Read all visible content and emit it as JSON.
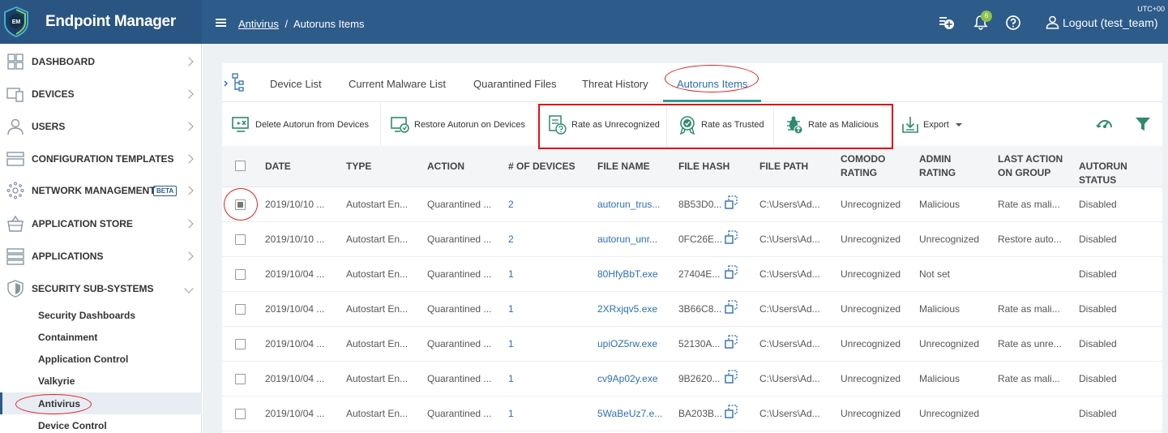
{
  "header": {
    "logo_text": "EM",
    "app_title": "Endpoint Manager",
    "breadcrumb_link": "Antivirus",
    "breadcrumb_sep": "/",
    "breadcrumb_current": "Autoruns Items",
    "timezone": "UTC+00",
    "notification_count": "6",
    "logout_label": "Logout (test_team)"
  },
  "sidebar": {
    "items": [
      {
        "label": "DASHBOARD",
        "icon": "dashboard-grid-icon"
      },
      {
        "label": "DEVICES",
        "icon": "devices-icon"
      },
      {
        "label": "USERS",
        "icon": "user-icon"
      },
      {
        "label": "CONFIGURATION TEMPLATES",
        "icon": "templates-icon"
      },
      {
        "label": "NETWORK MANAGEMENT",
        "icon": "network-icon",
        "badge": "BETA"
      },
      {
        "label": "APPLICATION STORE",
        "icon": "store-icon"
      },
      {
        "label": "APPLICATIONS",
        "icon": "applications-icon"
      },
      {
        "label": "SECURITY SUB-SYSTEMS",
        "icon": "shield-icon"
      }
    ],
    "sub_items": [
      {
        "label": "Security Dashboards"
      },
      {
        "label": "Containment"
      },
      {
        "label": "Application Control"
      },
      {
        "label": "Valkyrie"
      },
      {
        "label": "Antivirus"
      },
      {
        "label": "Device Control"
      }
    ]
  },
  "tabs": [
    {
      "label": "Device List"
    },
    {
      "label": "Current Malware List"
    },
    {
      "label": "Quarantined Files"
    },
    {
      "label": "Threat History"
    },
    {
      "label": "Autoruns Items"
    }
  ],
  "toolbar": {
    "delete_label": "Delete Autorun from Devices",
    "restore_label": "Restore Autorun on Devices",
    "unrecognized_label": "Rate as Unrecognized",
    "trusted_label": "Rate as Trusted",
    "malicious_label": "Rate as Malicious",
    "export_label": "Export"
  },
  "table": {
    "headers": {
      "date": "DATE",
      "type": "TYPE",
      "action": "ACTION",
      "devices": "# OF DEVICES",
      "file_name": "FILE NAME",
      "file_hash": "FILE HASH",
      "file_path": "FILE PATH",
      "comodo_1": "COMODO",
      "comodo_2": "RATING",
      "admin_1": "ADMIN",
      "admin_2": "RATING",
      "last_1": "LAST ACTION",
      "last_2": "ON GROUP",
      "status": "AUTORUN STATUS"
    },
    "rows": [
      {
        "date": "2019/10/10 ...",
        "type": "Autostart En...",
        "action": "Quarantined ...",
        "devices": "2",
        "file_name": "autorun_trus...",
        "file_hash": "8B53D0...",
        "file_path": "C:\\Users\\Ad...",
        "comodo": "Unrecognized",
        "admin": "Malicious",
        "last_action": "Rate as mali...",
        "status": "Disabled",
        "checked": true
      },
      {
        "date": "2019/10/10 ...",
        "type": "Autostart En...",
        "action": "Quarantined ...",
        "devices": "2",
        "file_name": "autorun_unr...",
        "file_hash": "0FC26E...",
        "file_path": "C:\\Users\\Ad...",
        "comodo": "Unrecognized",
        "admin": "Unrecognized",
        "last_action": "Restore auto...",
        "status": "Disabled",
        "checked": false
      },
      {
        "date": "2019/10/04 ...",
        "type": "Autostart En...",
        "action": "Quarantined ...",
        "devices": "1",
        "file_name": "80HfyBbT.exe",
        "file_hash": "27404E...",
        "file_path": "C:\\Users\\Ad...",
        "comodo": "Unrecognized",
        "admin": "Not set",
        "last_action": "",
        "status": "Disabled",
        "checked": false
      },
      {
        "date": "2019/10/04 ...",
        "type": "Autostart En...",
        "action": "Quarantined ...",
        "devices": "1",
        "file_name": "2XRxjqv5.exe",
        "file_hash": "3B66C8...",
        "file_path": "C:\\Users\\Ad...",
        "comodo": "Unrecognized",
        "admin": "Malicious",
        "last_action": "Rate as mali...",
        "status": "Disabled",
        "checked": false
      },
      {
        "date": "2019/10/04 ...",
        "type": "Autostart En...",
        "action": "Quarantined ...",
        "devices": "1",
        "file_name": "upiOZ5rw.exe",
        "file_hash": "52130A...",
        "file_path": "C:\\Users\\Ad...",
        "comodo": "Unrecognized",
        "admin": "Unrecognized",
        "last_action": "Rate as unre...",
        "status": "Disabled",
        "checked": false
      },
      {
        "date": "2019/10/04 ...",
        "type": "Autostart En...",
        "action": "Quarantined ...",
        "devices": "1",
        "file_name": "cv9Ap02y.exe",
        "file_hash": "9B2620...",
        "file_path": "C:\\Users\\Ad...",
        "comodo": "Unrecognized",
        "admin": "Malicious",
        "last_action": "Rate as mali...",
        "status": "Disabled",
        "checked": false
      },
      {
        "date": "2019/10/04 ...",
        "type": "Autostart En...",
        "action": "Quarantined ...",
        "devices": "1",
        "file_name": "5WaBeUz7.e...",
        "file_hash": "BA203B...",
        "file_path": "C:\\Users\\Ad...",
        "comodo": "Unrecognized",
        "admin": "Unrecognized",
        "last_action": "",
        "status": "Disabled",
        "checked": false
      }
    ]
  },
  "colors": {
    "header_bg": "#2d5b8a",
    "link": "#2d6fb0",
    "tab_underline": "#2e9e8e",
    "annotation_red": "#e02020"
  }
}
